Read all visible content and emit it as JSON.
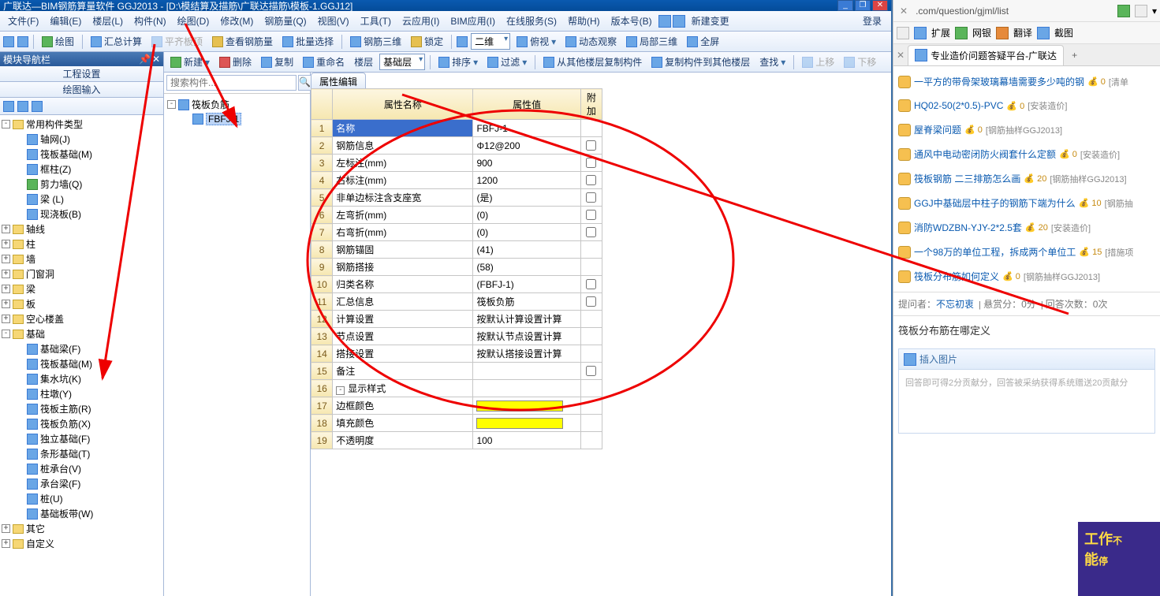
{
  "title": "广联达—BIM钢筋算量软件 GGJ2013 - [D:\\模结算及描筋\\广联达描筋\\模板-1.GGJ12]",
  "menus": [
    "文件(F)",
    "编辑(E)",
    "楼层(L)",
    "构件(N)",
    "绘图(D)",
    "修改(M)",
    "钢筋量(Q)",
    "视图(V)",
    "工具(T)",
    "云应用(I)",
    "BIM应用(I)",
    "在线服务(S)",
    "帮助(H)",
    "版本号(B)"
  ],
  "menu_extra_label": "新建变更",
  "login": "登录",
  "toolbar1": {
    "draw": "绘图",
    "sum": "汇总计算",
    "slabtop": "平齐板顶",
    "viewbar": "查看钢筋量",
    "batch_sel": "批量选择",
    "bar3d": "钢筋三维",
    "lock": "锁定",
    "combo2d": "二维",
    "overview": "俯视",
    "dynview": "动态观察",
    "local3d": "局部三维",
    "fullscreen": "全屏"
  },
  "nav": {
    "title": "模块导航栏",
    "tab1": "工程设置",
    "tab2": "绘图输入",
    "tree": {
      "root": "常用构件类型",
      "items1": [
        "轴网(J)",
        "筏板基础(M)",
        "框柱(Z)",
        "剪力墙(Q)",
        "梁 (L)",
        "现浇板(B)"
      ],
      "roots2": [
        "轴线",
        "柱",
        "墙",
        "门窗洞",
        "梁",
        "板",
        "空心楼盖"
      ],
      "foundation": "基础",
      "foundation_items": [
        "基础梁(F)",
        "筏板基础(M)",
        "集水坑(K)",
        "柱墩(Y)",
        "筏板主筋(R)",
        "筏板负筋(X)",
        "独立基础(F)",
        "条形基础(T)",
        "桩承台(V)",
        "承台梁(F)",
        "桩(U)",
        "基础板带(W)"
      ],
      "roots3": [
        "其它",
        "自定义"
      ]
    }
  },
  "toolbar2": {
    "new": "新建",
    "del": "删除",
    "copy": "复制",
    "rename": "重命名",
    "floor": "楼层",
    "basic_floor": "基础层",
    "sort": "排序",
    "filter": "过滤",
    "copy_from": "从其他楼层复制构件",
    "copy_to": "复制构件到其他楼层",
    "find": "查找",
    "up": "上移",
    "down": "下移"
  },
  "search_placeholder": "搜索构件...",
  "comp_tree": {
    "root": "筏板负筋",
    "item": "FBFJ-1"
  },
  "prop_tab": "属性编辑",
  "prop_headers": {
    "name": "属性名称",
    "value": "属性值",
    "extra": "附加"
  },
  "props": [
    {
      "n": "名称",
      "v": "FBFJ-1",
      "sel": true
    },
    {
      "n": "钢筋信息",
      "v": "Φ12@200",
      "c": true
    },
    {
      "n": "左标注(mm)",
      "v": "900",
      "c": true
    },
    {
      "n": "右标注(mm)",
      "v": "1200",
      "c": true
    },
    {
      "n": "非单边标注含支座宽",
      "v": "(是)",
      "c": true
    },
    {
      "n": "左弯折(mm)",
      "v": "(0)",
      "c": true
    },
    {
      "n": "右弯折(mm)",
      "v": "(0)",
      "c": true
    },
    {
      "n": "钢筋锚固",
      "v": "(41)"
    },
    {
      "n": "钢筋搭接",
      "v": "(58)"
    },
    {
      "n": "归类名称",
      "v": "(FBFJ-1)",
      "c": true
    },
    {
      "n": "汇总信息",
      "v": "筏板负筋",
      "c": true
    },
    {
      "n": "计算设置",
      "v": "按默认计算设置计算"
    },
    {
      "n": "节点设置",
      "v": "按默认节点设置计算"
    },
    {
      "n": "搭接设置",
      "v": "按默认搭接设置计算"
    },
    {
      "n": "备注",
      "v": "",
      "c": true
    },
    {
      "n": "显示样式",
      "hdr": true
    },
    {
      "n": "边框颜色",
      "color": "#ffff00"
    },
    {
      "n": "填充颜色",
      "color": "#ffff00"
    },
    {
      "n": "不透明度",
      "v": "100"
    }
  ],
  "browser": {
    "url": ".com/question/gjml/list",
    "ext": [
      "扩展",
      "网银",
      "翻译",
      "截图"
    ],
    "tab": "专业造价问题答疑平台-广联达",
    "questions": [
      {
        "t": "一平方的带骨架玻璃幕墙需要多少吨的钢",
        "c": "0",
        "cat": "[清单"
      },
      {
        "t": "HQ02-50(2*0.5)-PVC",
        "c": "0",
        "cat": "[安装造价]"
      },
      {
        "t": "屋脊梁问题",
        "c": "0",
        "cat": "[钢筋抽样GGJ2013]"
      },
      {
        "t": "通风中电动密闭防火阀套什么定额",
        "c": "0",
        "cat": "[安装造价]"
      },
      {
        "t": "筏板钢筋 二三排筋怎么画",
        "c": "20",
        "cat": "[钢筋抽样GGJ2013]"
      },
      {
        "t": "GGJ中基础层中柱子的钢筋下端为什么",
        "c": "10",
        "cat": "[钢筋抽"
      },
      {
        "t": "消防WDZBN-YJY-2*2.5套",
        "c": "20",
        "cat": "[安装造价]"
      },
      {
        "t": "一个98万的单位工程，拆成两个单位工",
        "c": "15",
        "cat": "[措施项"
      },
      {
        "t": "筏板分布筋如何定义",
        "c": "0",
        "cat": "[钢筋抽样GGJ2013]"
      }
    ],
    "meta": {
      "asker_l": "提问者：",
      "asker": "不忘初衷",
      "bounty": "悬赏分：0分",
      "answers": "回答次数：0次"
    },
    "qtitle": "筏板分布筋在哪定义",
    "insert_img": "插入图片",
    "answer_hint": "回答即可得2分贡献分，回答被采纳获得系统赠送20贡献分",
    "promo": "工作不能停"
  }
}
